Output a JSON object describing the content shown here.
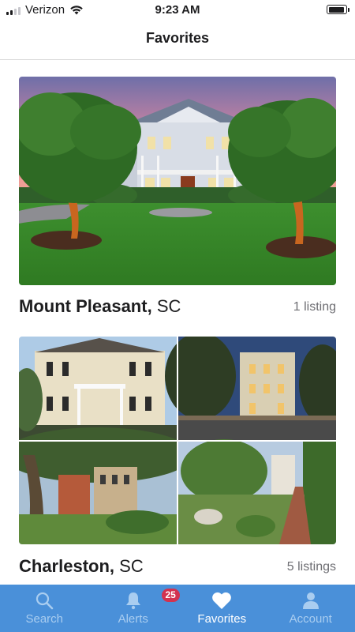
{
  "status_bar": {
    "carrier": "Verizon",
    "time": "9:23 AM",
    "signal_bars": 2
  },
  "header": {
    "title": "Favorites"
  },
  "favorites": [
    {
      "city": "Mount Pleasant,",
      "state": "SC",
      "count": "1 listing",
      "image": "house-photo"
    },
    {
      "city": "Charleston,",
      "state": "SC",
      "count": "5 listings",
      "image": "house-collage"
    }
  ],
  "tab_bar": {
    "tabs": [
      {
        "label": "Search",
        "icon": "search-icon"
      },
      {
        "label": "Alerts",
        "icon": "bell-icon",
        "badge": "25"
      },
      {
        "label": "Favorites",
        "icon": "heart-icon",
        "active": true
      },
      {
        "label": "Account",
        "icon": "person-icon"
      }
    ]
  },
  "colors": {
    "tab_bar": "#4a90d9",
    "badge": "#d3324f",
    "active_tab": "#ffffff",
    "inactive_tab": "#a9cdf0"
  }
}
